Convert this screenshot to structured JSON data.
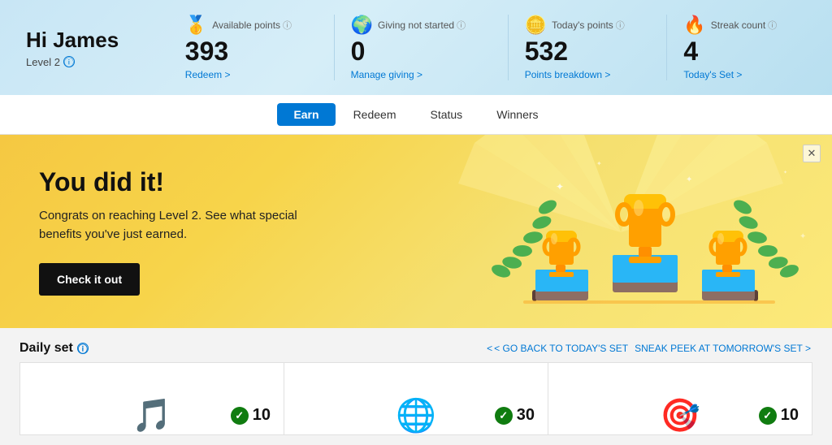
{
  "header": {
    "greeting": "Hi James",
    "level": "Level 2",
    "level_info_title": "Level info",
    "stats": [
      {
        "icon": "🥇",
        "label": "Available points",
        "value": "393",
        "link": "Redeem >",
        "link_href": "#"
      },
      {
        "icon": "🌍",
        "label": "Giving not started",
        "value": "0",
        "link": "Manage giving >",
        "link_href": "#"
      },
      {
        "icon": "🪙",
        "label": "Today's points",
        "value": "532",
        "link": "Points breakdown >",
        "link_href": "#"
      },
      {
        "icon": "🔥",
        "label": "Streak count",
        "value": "4",
        "link": "Today's Set >",
        "link_href": "#"
      }
    ]
  },
  "nav": {
    "tabs": [
      {
        "label": "Earn",
        "active": true
      },
      {
        "label": "Redeem",
        "active": false
      },
      {
        "label": "Status",
        "active": false
      },
      {
        "label": "Winners",
        "active": false
      }
    ]
  },
  "banner": {
    "headline": "You did it!",
    "body": "Congrats on reaching Level 2. See what special benefits you've just earned.",
    "cta_label": "Check it out",
    "close_label": "✕"
  },
  "daily_set": {
    "title": "Daily set",
    "nav_left": "< GO BACK TO TODAY'S SET",
    "nav_right": "SNEAK PEEK AT TOMORROW'S SET >",
    "cards": [
      {
        "points": 10,
        "completed": true
      },
      {
        "points": 30,
        "completed": true
      },
      {
        "points": 10,
        "completed": true
      }
    ]
  }
}
